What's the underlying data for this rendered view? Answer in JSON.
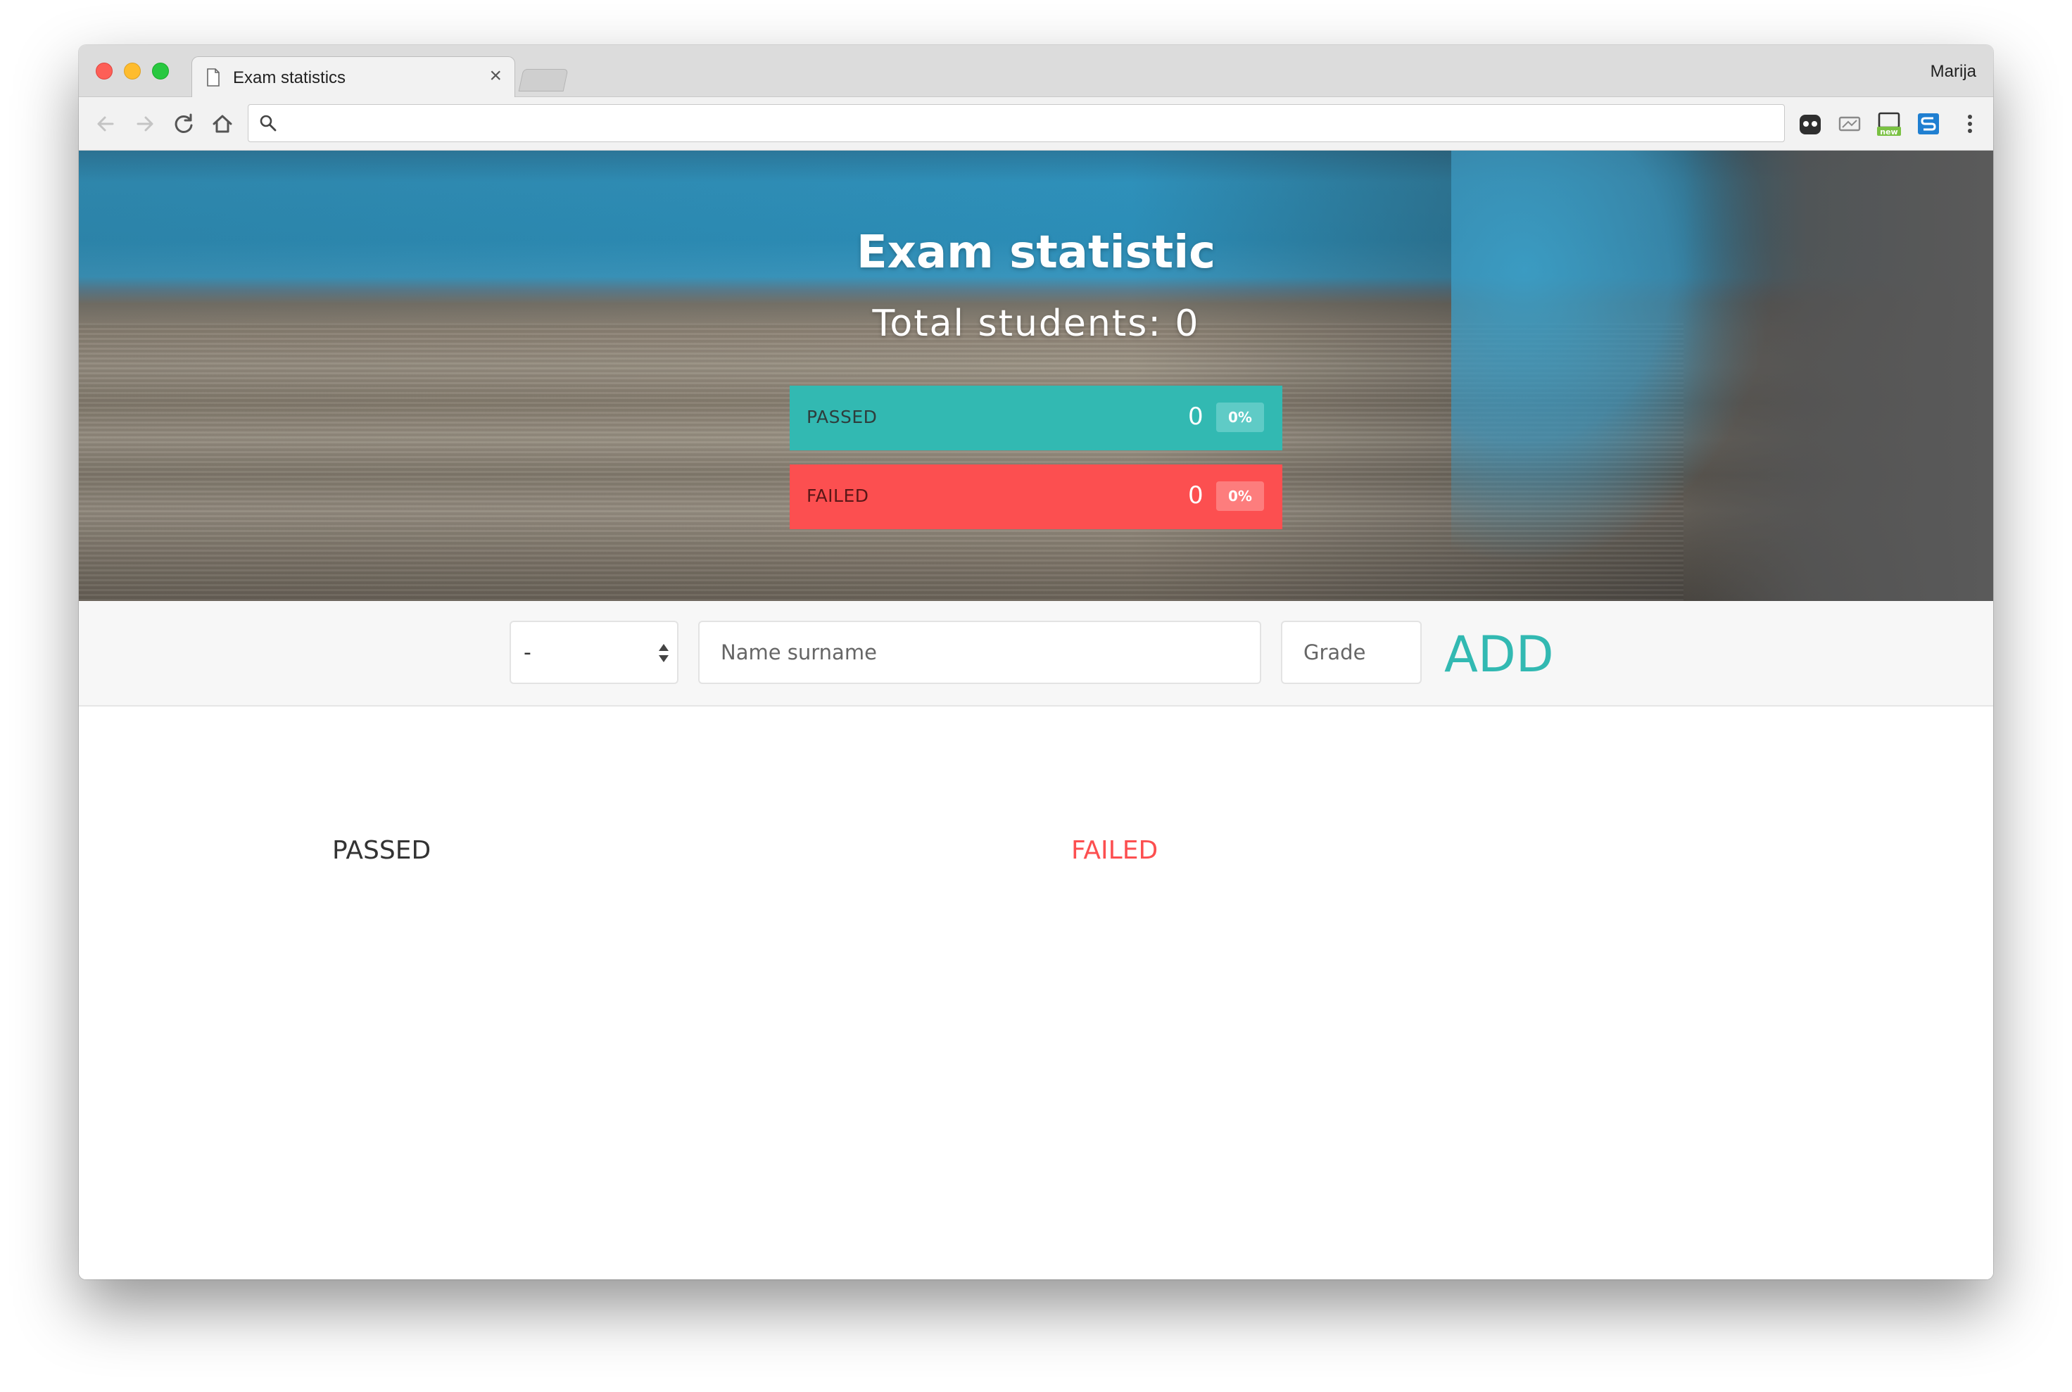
{
  "browser": {
    "tab_title": "Exam statistics",
    "tab_close": "×",
    "profile_name": "Marija",
    "address_value": "",
    "extensions": [
      "ghostery-icon",
      "screen-capture-icon",
      "new-badge-extension-icon",
      "s-extension-icon"
    ],
    "extension_badge": "new"
  },
  "hero": {
    "title": "Exam statistic",
    "total_students": "Total students: 0",
    "passed": {
      "label": "PASSED",
      "count": "0",
      "percent": "0%"
    },
    "failed": {
      "label": "FAILED",
      "count": "0",
      "percent": "0%"
    }
  },
  "form": {
    "select_value": "-",
    "name_placeholder": "Name surname",
    "grade_placeholder": "Grade",
    "add_label": "ADD"
  },
  "lists": {
    "passed_heading": "PASSED",
    "failed_heading": "FAILED"
  },
  "colors": {
    "passed": "#32b9b2",
    "failed": "#fc4f50",
    "add": "#32b9b2"
  }
}
